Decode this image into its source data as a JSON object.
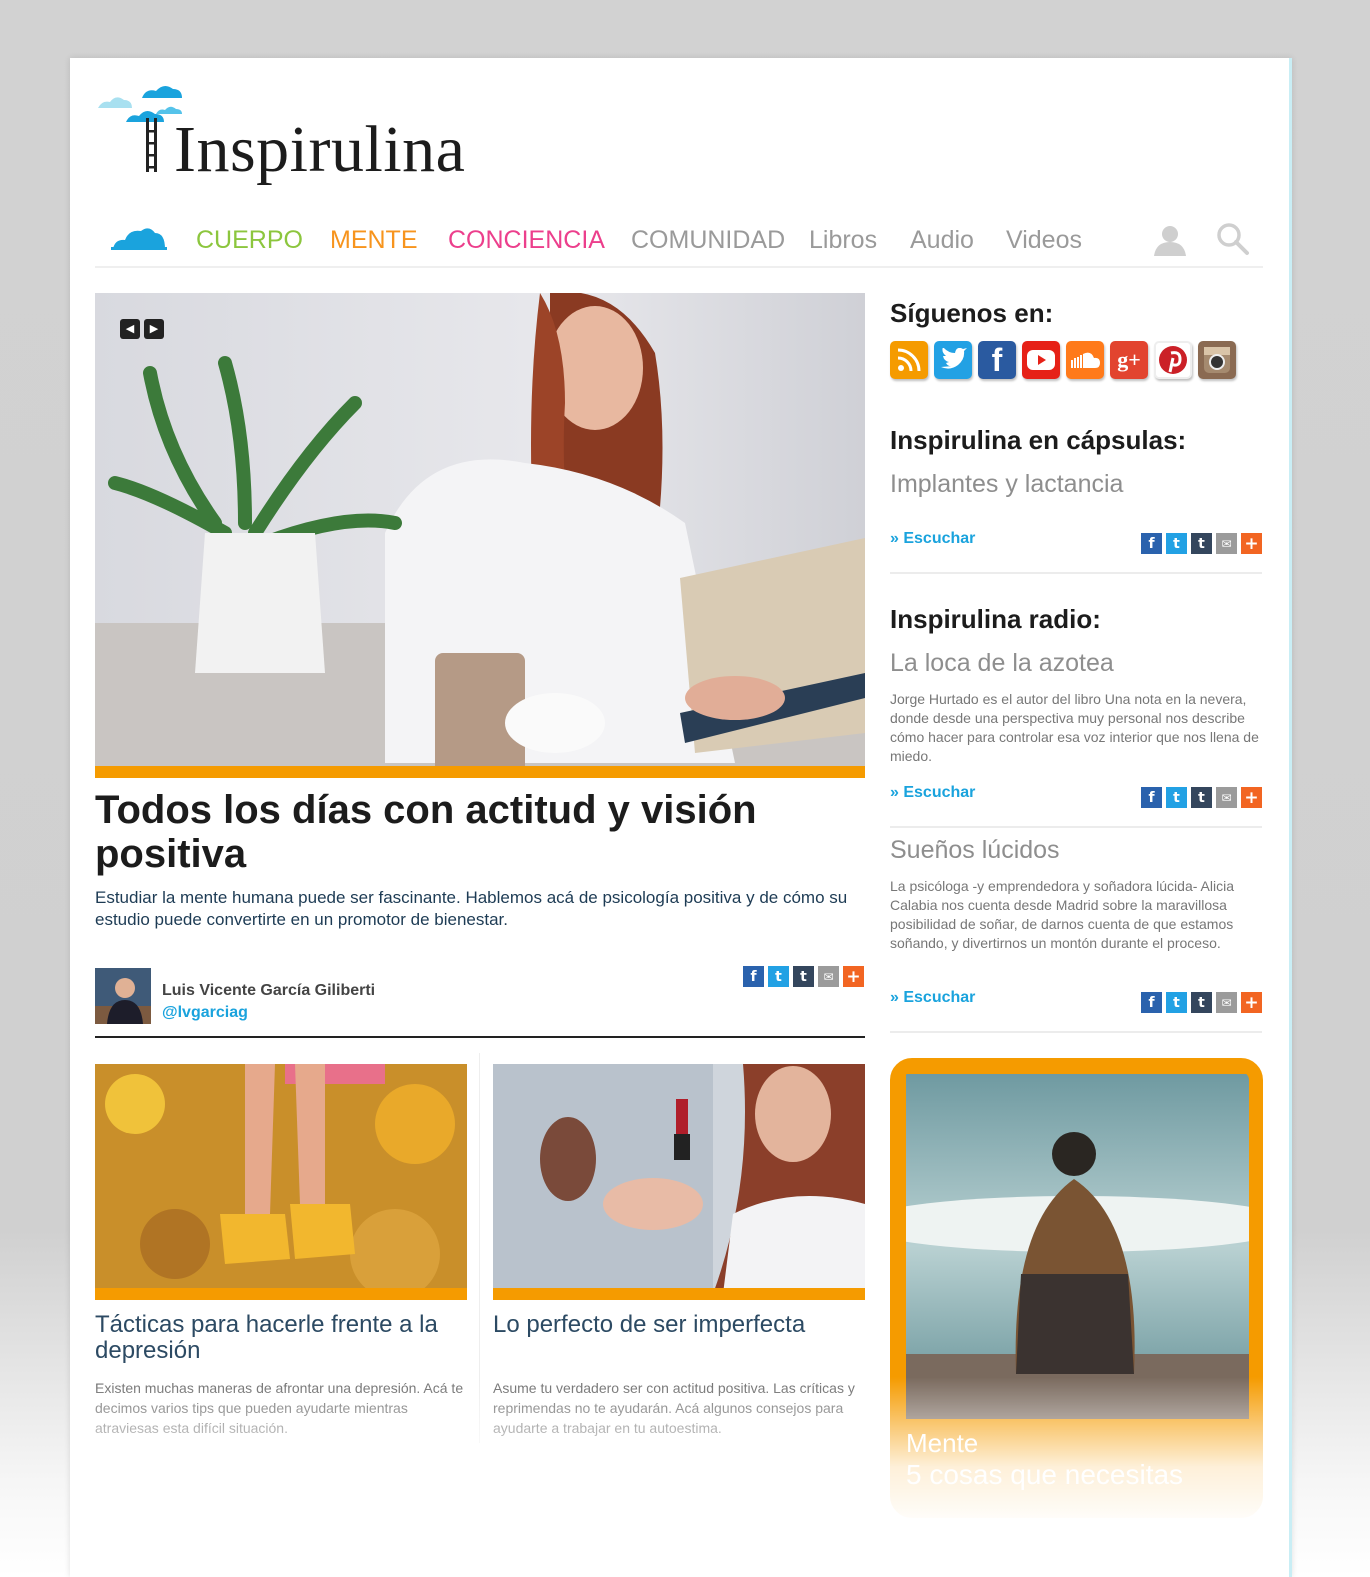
{
  "site": {
    "logo_text": "Inspirulina",
    "brand_colors": {
      "orange": "#f59b00",
      "blue": "#1aa3dd",
      "cuerpo": "#8cc63e",
      "mente": "#f7941d",
      "conciencia": "#ec3f8c",
      "gray": "#9a9a9a"
    }
  },
  "nav": {
    "home_icon": "cloud-icon",
    "items": [
      {
        "label": "CUERPO",
        "color": "#8cc63e"
      },
      {
        "label": "MENTE",
        "color": "#f7941d"
      },
      {
        "label": "CONCIENCIA",
        "color": "#ec3f8c"
      },
      {
        "label": "COMUNIDAD",
        "color": "#9a9a9a"
      },
      {
        "label": "Libros",
        "color": "#9a9a9a"
      },
      {
        "label": "Audio",
        "color": "#9a9a9a"
      },
      {
        "label": "Videos",
        "color": "#9a9a9a"
      }
    ],
    "user_icon": "user-icon",
    "search_icon": "search-icon"
  },
  "hero": {
    "slider_prev": "◀",
    "slider_next": "▶",
    "title": "Todos los días con actitud y visión positiva",
    "excerpt": "Estudiar la mente humana puede ser fascinante. Hablemos acá de psicología positiva y de cómo su estudio puede convertirte en un promotor de bienestar.",
    "author_name": "Luis Vicente García Giliberti",
    "author_handle": "@lvgarciag"
  },
  "share_labels": {
    "facebook": "f",
    "twitter": "t",
    "tumblr": "t",
    "email": "✉",
    "more": "+"
  },
  "cards": [
    {
      "title": "Tácticas para hacerle frente a la depresión",
      "excerpt": "Existen muchas maneras de afrontar una depresión. Acá te decimos varios tips que pueden ayudarte mientras atraviesas esta difícil situación."
    },
    {
      "title": "Lo perfecto de ser imperfecta",
      "excerpt": "Asume tu verdadero ser con actitud positiva. Las críticas y reprimendas no te ayudarán. Acá algunos consejos para ayudarte a trabajar en tu autoestima."
    }
  ],
  "sidebar": {
    "follow_heading": "Síguenos en:",
    "social": [
      "rss-icon",
      "twitter-icon",
      "facebook-icon",
      "youtube-icon",
      "soundcloud-icon",
      "googleplus-icon",
      "pinterest-icon",
      "instagram-icon"
    ],
    "capsules_heading": "Inspirulina en cápsulas:",
    "capsule_title": "Implantes y lactancia",
    "listen_label": "» Escuchar",
    "radio_heading": "Inspirulina radio:",
    "radio_items": [
      {
        "title": "La loca de la azotea",
        "text": "Jorge Hurtado es el autor del libro Una nota en la nevera, donde desde una perspectiva muy personal nos describe cómo hacer para controlar esa voz interior que nos llena de miedo."
      },
      {
        "title": "Sueños lúcidos",
        "text": "La psicóloga -y emprendedora y soñadora lúcida- Alicia Calabia nos cuenta desde Madrid sobre la maravillosa posibilidad de soñar, de darnos cuenta de que estamos soñando, y divertirnos un montón durante el proceso."
      }
    ],
    "promo_category": "Mente",
    "promo_title": "5 cosas que necesitas"
  }
}
